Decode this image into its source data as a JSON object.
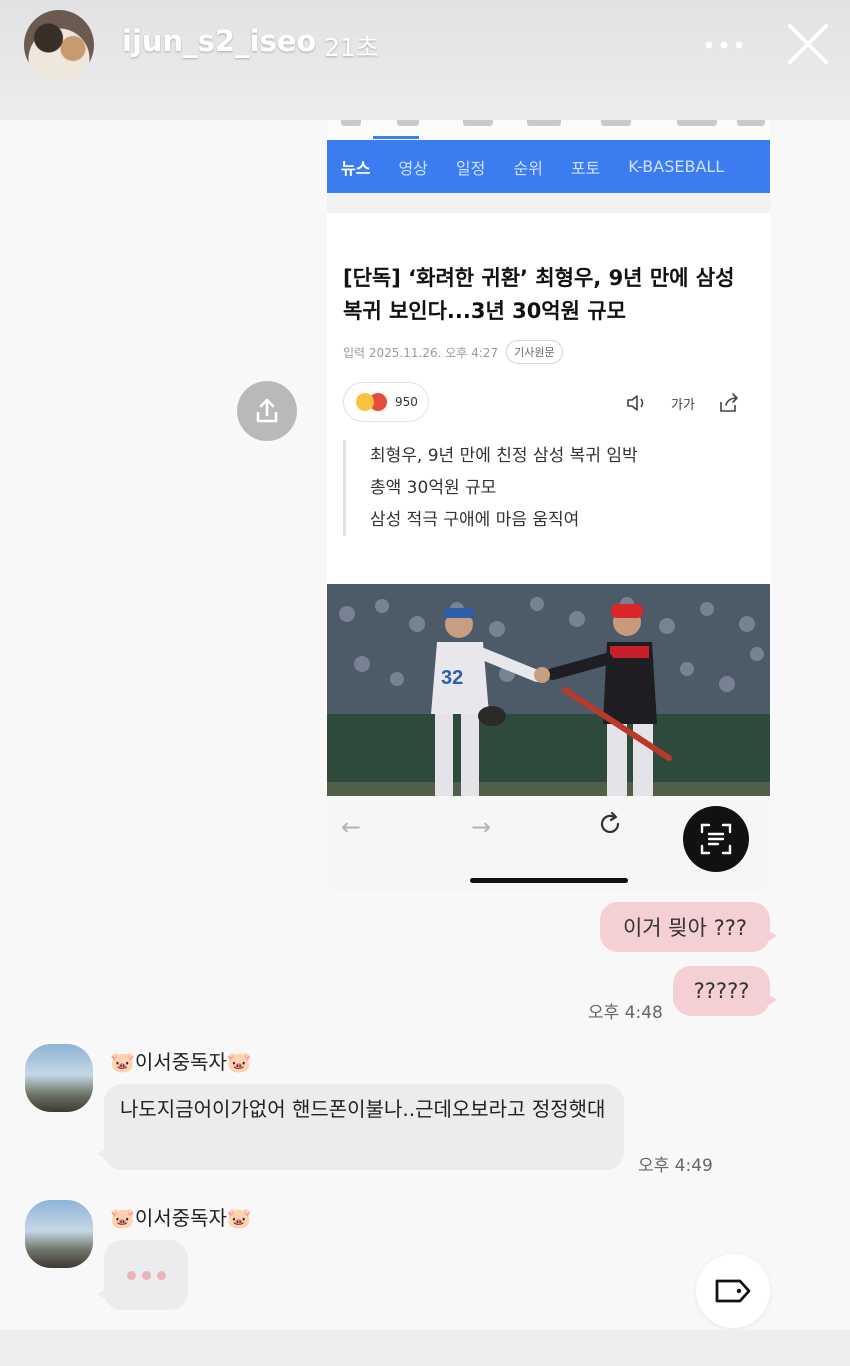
{
  "story": {
    "username": "ijun_s2_iseo",
    "time_ago": "21초"
  },
  "article": {
    "nav_tabs": [
      "뉴스",
      "영상",
      "일정",
      "순위",
      "포토",
      "K-BASEBALL"
    ],
    "headline": "[단독] ‘화려한 귀환’ 최형우, 9년 만에 삼성 복귀 보인다...3년 30억원 규모",
    "date": "입력 2025.11.26. 오후 4:27",
    "source_button": "기사원문",
    "reaction_count": "950",
    "font_size_label": "가가",
    "summary": [
      "최형우, 9년 만에 친정 삼성 복귀 임박",
      "총액 30억원 규모",
      "삼성 적극 구애에 마음 움직여"
    ]
  },
  "chat": {
    "outgoing": [
      {
        "text": "이거 믲아 ???"
      },
      {
        "text": "?????"
      }
    ],
    "outgoing_time": "오후 4:48",
    "friend_name": "🐷이서중독자🐷",
    "incoming_message": "나도지금어이가없어 핸드폰이불나..근데오보라고 정정햇대",
    "incoming_time": "오후 4:49"
  },
  "colors": {
    "nav_blue": "#3b7cf0",
    "outgoing_bubble": "#f4cfd4",
    "incoming_bubble": "#ececee"
  }
}
